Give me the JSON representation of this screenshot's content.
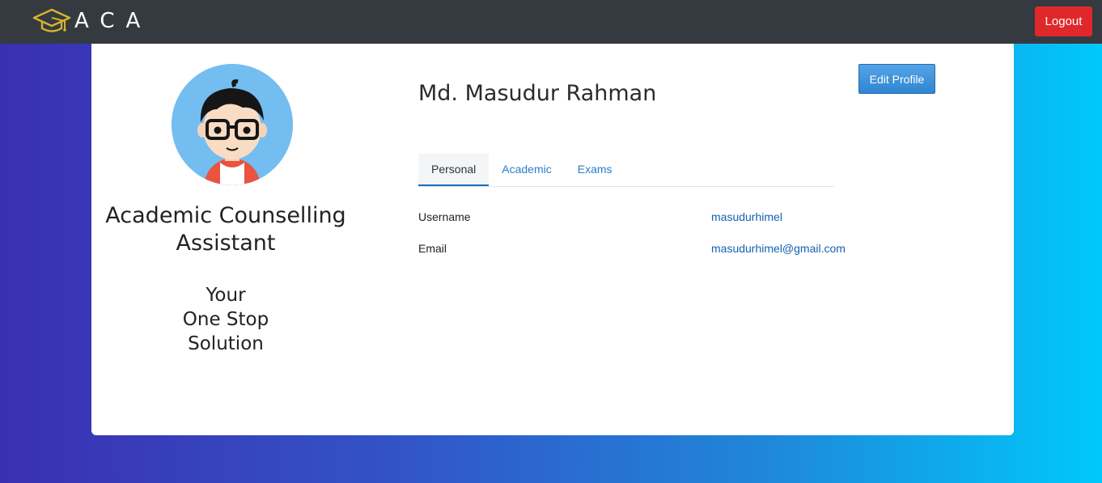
{
  "navbar": {
    "brand_text": "ACA",
    "logout_label": "Logout"
  },
  "sidebar": {
    "title": "Academic Counselling Assistant",
    "tagline": [
      "Your",
      "One Stop",
      "Solution"
    ]
  },
  "profile": {
    "name": "Md. Masudur Rahman",
    "edit_label": "Edit Profile",
    "tabs": [
      {
        "label": "Personal",
        "active": true
      },
      {
        "label": "Academic",
        "active": false
      },
      {
        "label": "Exams",
        "active": false
      }
    ],
    "fields": [
      {
        "label": "Username",
        "value": "masudurhimel"
      },
      {
        "label": "Email",
        "value": "masudurhimel@gmail.com"
      }
    ]
  },
  "colors": {
    "navbar_bg": "#343a40",
    "logout_bg": "#e0282b",
    "edit_bg": "#3a8fd8",
    "link": "#1262b0",
    "gradient_start": "#3a2fb3",
    "gradient_end": "#00c8fb"
  }
}
